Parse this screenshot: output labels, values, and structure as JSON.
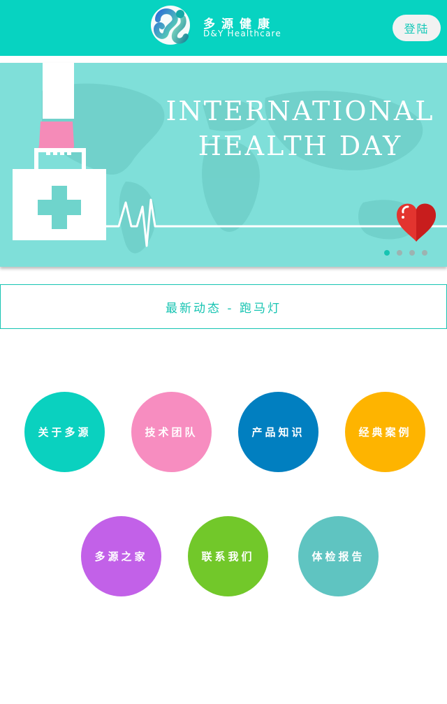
{
  "header": {
    "brand_cn": "多源健康",
    "brand_en": "D&Y Healthcare",
    "login_label": "登陆",
    "background_color": "#07d3c1"
  },
  "banner": {
    "title_line1": "INTERNATIONAL",
    "title_line2": "HEALTH DAY",
    "background_color": "#7fdfd9",
    "slide_count": 4,
    "active_slide": 1
  },
  "marquee": {
    "text": "最新动态 - 跑马灯"
  },
  "nav": {
    "items": [
      {
        "label": "关于多源",
        "color": "#0ad1bf"
      },
      {
        "label": "技术团队",
        "color": "#f78dc0"
      },
      {
        "label": "产品知识",
        "color": "#017fc0"
      },
      {
        "label": "经典案例",
        "color": "#feb400"
      },
      {
        "label": "多源之家",
        "color": "#c261e8"
      },
      {
        "label": "联系我们",
        "color": "#72c82a"
      },
      {
        "label": "体检报告",
        "color": "#5fc4c1"
      }
    ]
  }
}
